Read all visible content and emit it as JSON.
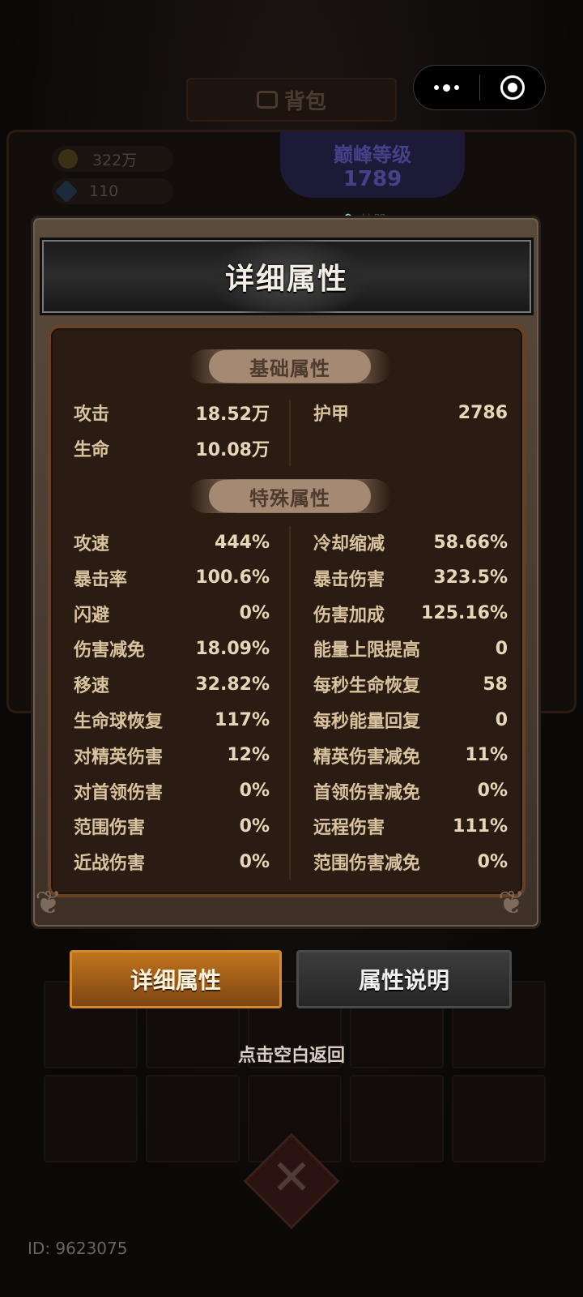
{
  "background": {
    "title": "背包",
    "coins": "322万",
    "gems": "110",
    "level_title": "巅峰等级",
    "level_value": "1789",
    "lock_text": "神器",
    "emblem": "✕"
  },
  "capsule": {
    "more_label": "•••",
    "close_label": "◎"
  },
  "modal": {
    "title": "详细属性",
    "basic_section": "基础属性",
    "special_section": "特殊属性",
    "basic": [
      {
        "k": "攻击",
        "v": "18.52万"
      },
      {
        "k": "护甲",
        "v": "2786"
      },
      {
        "k": "生命",
        "v": "10.08万"
      }
    ],
    "special_left": [
      {
        "k": "攻速",
        "v": "444%"
      },
      {
        "k": "暴击率",
        "v": "100.6%"
      },
      {
        "k": "闪避",
        "v": "0%"
      },
      {
        "k": "伤害减免",
        "v": "18.09%"
      },
      {
        "k": "移速",
        "v": "32.82%"
      },
      {
        "k": "生命球恢复",
        "v": "117%"
      },
      {
        "k": "对精英伤害",
        "v": "12%"
      },
      {
        "k": "对首领伤害",
        "v": "0%"
      },
      {
        "k": "范围伤害",
        "v": "0%"
      },
      {
        "k": "近战伤害",
        "v": "0%"
      }
    ],
    "special_right": [
      {
        "k": "冷却缩减",
        "v": "58.66%"
      },
      {
        "k": "暴击伤害",
        "v": "323.5%"
      },
      {
        "k": "伤害加成",
        "v": "125.16%"
      },
      {
        "k": "能量上限提高",
        "v": "0"
      },
      {
        "k": "每秒生命恢复",
        "v": "58"
      },
      {
        "k": "每秒能量回复",
        "v": "0"
      },
      {
        "k": "精英伤害减免",
        "v": "11%"
      },
      {
        "k": "首领伤害减免",
        "v": "0%"
      },
      {
        "k": "远程伤害",
        "v": "111%"
      },
      {
        "k": "范围伤害减免",
        "v": "0%"
      }
    ]
  },
  "tabs": {
    "detail": "详细属性",
    "explain": "属性说明"
  },
  "hint": "点击空白返回",
  "footer_id": "ID: 9623075",
  "colors": {
    "accent_orange": "#c0741e",
    "panel_brown": "#2a1c12",
    "text_gold": "#d9c39f"
  }
}
